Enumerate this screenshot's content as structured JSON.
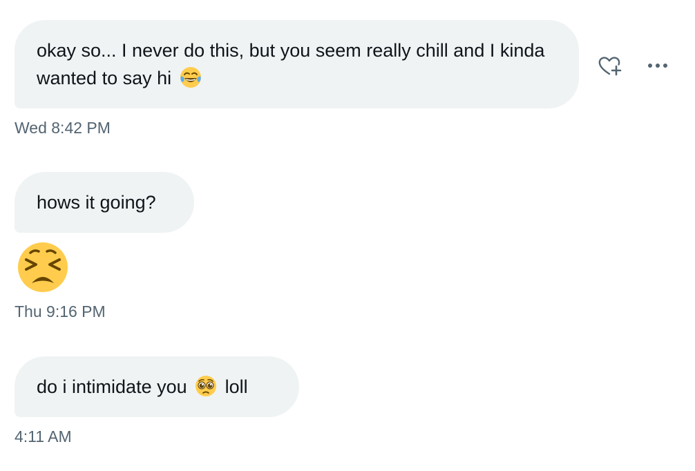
{
  "messages": [
    {
      "text_before": "okay so... I never do this, but you seem really chill and I kinda wanted to say hi",
      "emoji": "tears-of-joy-emoji",
      "timestamp": "Wed 8:42 PM"
    },
    {
      "text": "hows it going?"
    },
    {
      "emoji": "persevering-face-emoji",
      "timestamp": "Thu 9:16 PM"
    },
    {
      "text_before": "do i intimidate you",
      "emoji": "pleading-face-emoji",
      "text_after": "loll",
      "timestamp": "4:11 AM"
    }
  ],
  "actions": {
    "react_icon": "heart-plus-icon",
    "more_icon": "more-horizontal-icon"
  },
  "colors": {
    "bubble_bg": "#eff3f4",
    "text": "#0f1419",
    "timestamp": "#536471",
    "emoji_yellow": "#ffcc4d",
    "icon": "#536471"
  }
}
